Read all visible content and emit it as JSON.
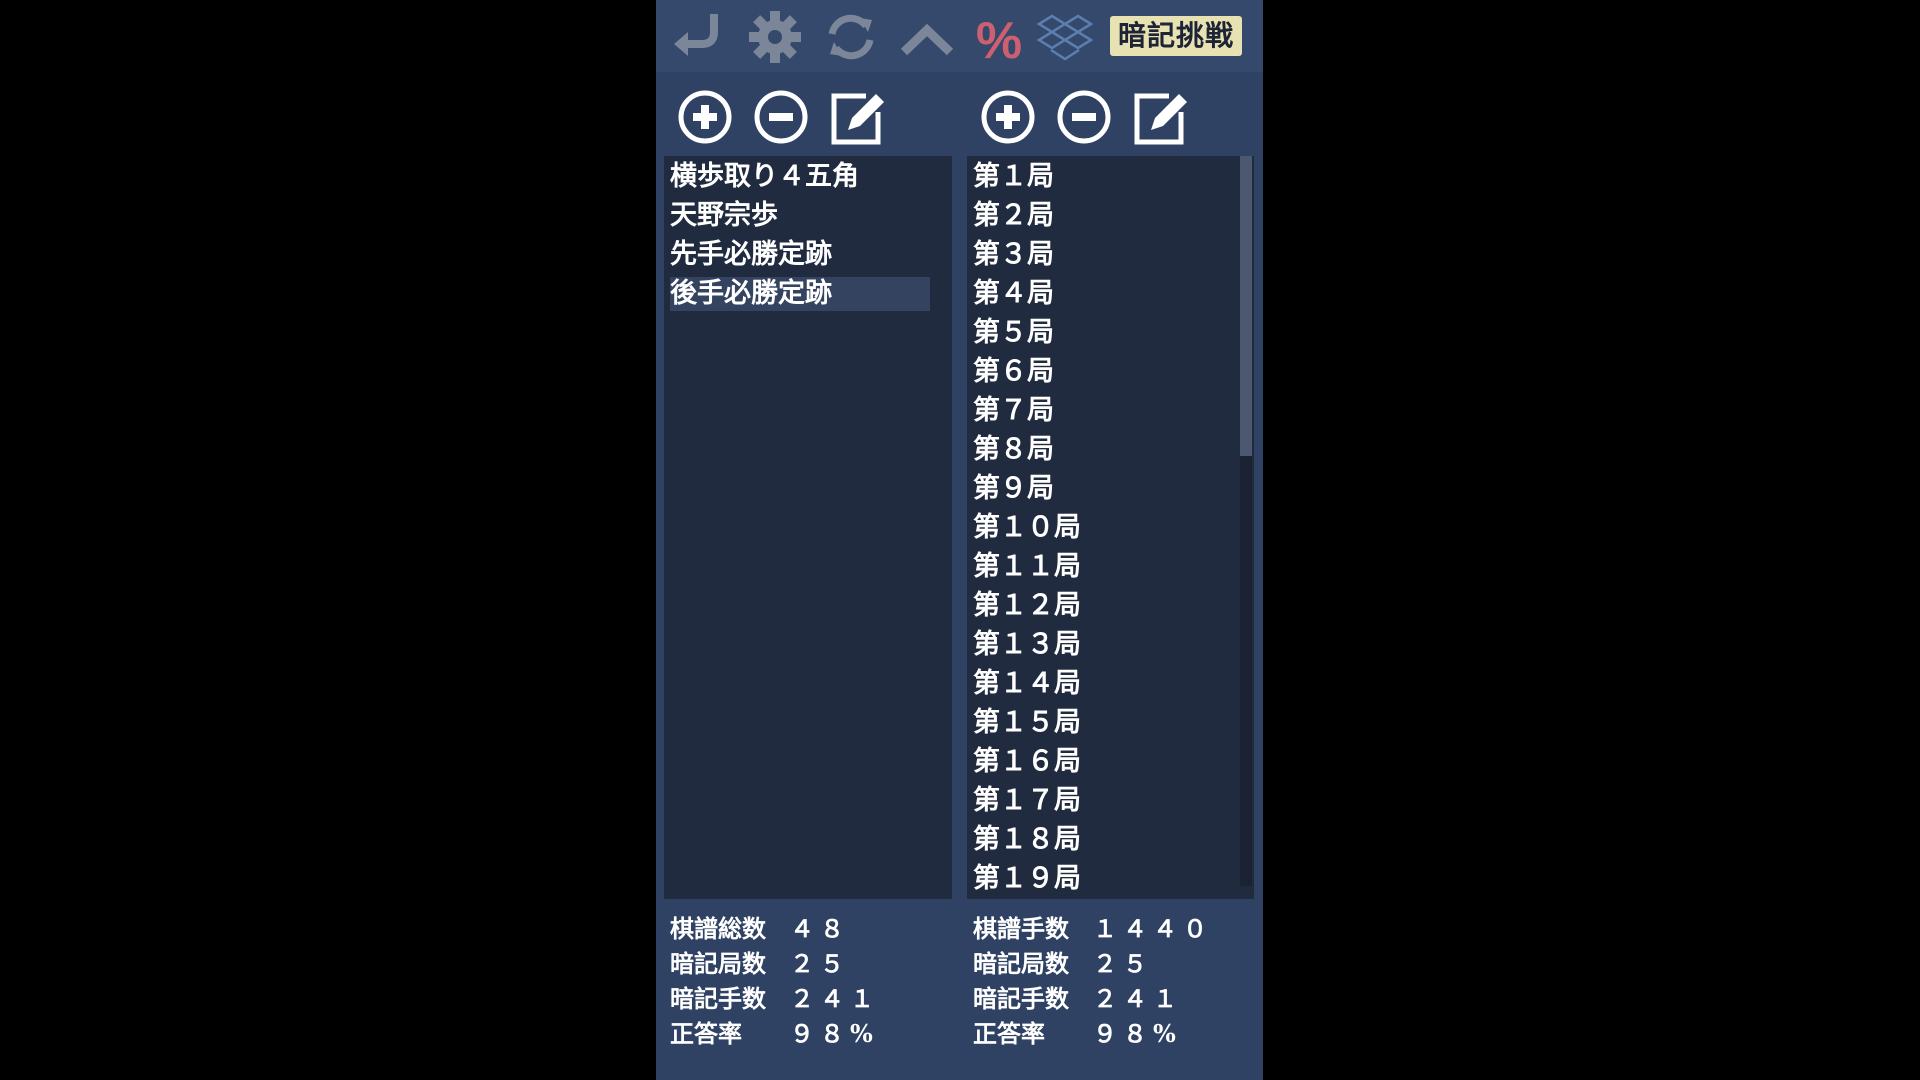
{
  "toolbar": {
    "icons": [
      "undo-icon",
      "gear-icon",
      "refresh-icon",
      "chevron-up-icon",
      "percent-icon",
      "dropbox-icon"
    ],
    "challenge_label": "暗記挑戦",
    "colors": {
      "icon": "#7b8699",
      "percent": "#cc6070",
      "dropbox": "#5c7fb0",
      "challenge_bg": "#e8e2b2"
    }
  },
  "left_panel": {
    "tools": [
      "add-icon",
      "remove-icon",
      "edit-icon"
    ],
    "items": [
      {
        "label": "横歩取り４五角"
      },
      {
        "label": "天野宗歩"
      },
      {
        "label": "先手必勝定跡"
      },
      {
        "label": "後手必勝定跡"
      }
    ],
    "selected_index": 3,
    "stats": [
      {
        "label": "棋譜総数",
        "value": "４８"
      },
      {
        "label": "暗記局数",
        "value": "２５"
      },
      {
        "label": "暗記手数",
        "value": "２４１"
      },
      {
        "label": "正答率",
        "value": "９８%"
      }
    ]
  },
  "right_panel": {
    "tools": [
      "add-icon",
      "remove-icon",
      "edit-icon"
    ],
    "items": [
      {
        "label": "第１局"
      },
      {
        "label": "第２局"
      },
      {
        "label": "第３局"
      },
      {
        "label": "第４局"
      },
      {
        "label": "第５局"
      },
      {
        "label": "第６局"
      },
      {
        "label": "第７局"
      },
      {
        "label": "第８局"
      },
      {
        "label": "第９局"
      },
      {
        "label": "第１０局"
      },
      {
        "label": "第１１局"
      },
      {
        "label": "第１２局"
      },
      {
        "label": "第１３局"
      },
      {
        "label": "第１４局"
      },
      {
        "label": "第１５局"
      },
      {
        "label": "第１６局"
      },
      {
        "label": "第１７局"
      },
      {
        "label": "第１８局"
      },
      {
        "label": "第１９局"
      }
    ],
    "stats": [
      {
        "label": "棋譜手数",
        "value": "１４４０"
      },
      {
        "label": "暗記局数",
        "value": "２５"
      },
      {
        "label": "暗記手数",
        "value": "２４１"
      },
      {
        "label": "正答率",
        "value": "９８%"
      }
    ]
  }
}
